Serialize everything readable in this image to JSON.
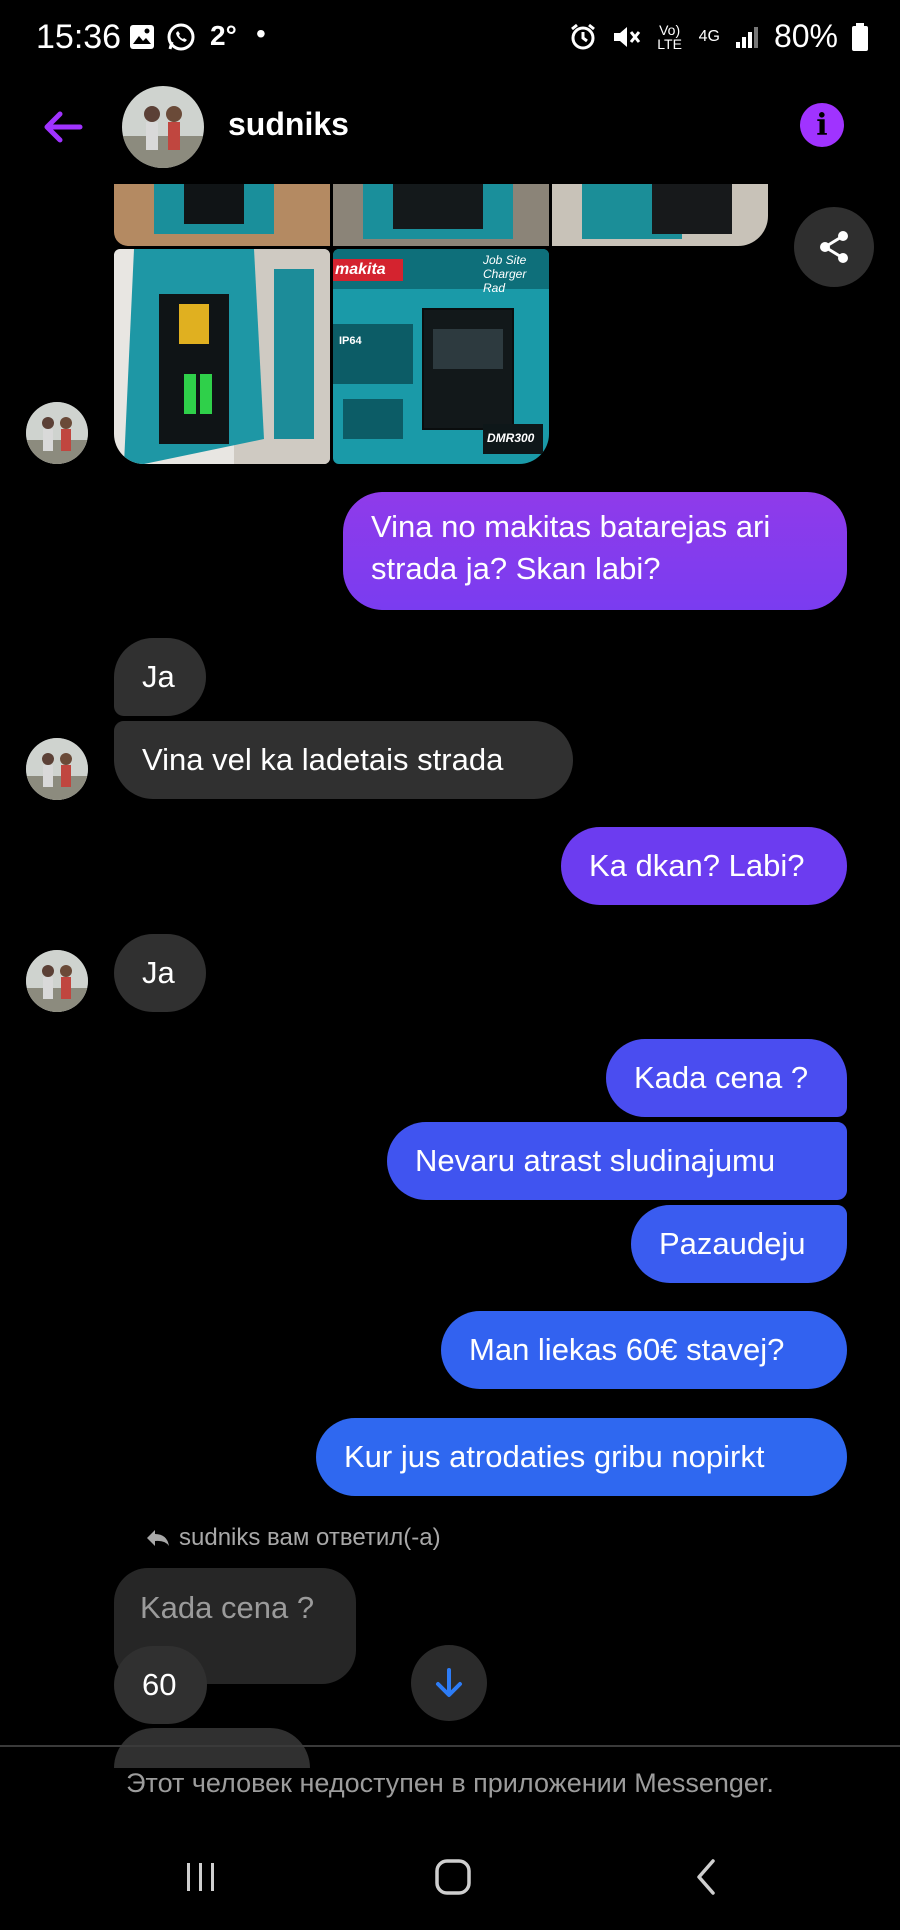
{
  "status_bar": {
    "time": "15:36",
    "temperature": "2°",
    "dot": "•",
    "network": "4G",
    "volte": "Vo) LTE",
    "battery": "80%"
  },
  "header": {
    "contact_name": "sudniks",
    "info_icon": "i"
  },
  "photos": {
    "box_brand": "makita",
    "box_title": "Job Site Charger Rad",
    "box_model": "DMR300",
    "box_rating": "IP64"
  },
  "messages": [
    {
      "from": "me",
      "text": "Vina no makitas batarejas ari strada ja? Skan labi?"
    },
    {
      "from": "them",
      "text": "Ja"
    },
    {
      "from": "them",
      "text": "Vina vel ka ladetais strada"
    },
    {
      "from": "me",
      "text": "Ka dkan? Labi?"
    },
    {
      "from": "them",
      "text": "Ja"
    },
    {
      "from": "me",
      "text": "Kada cena ?"
    },
    {
      "from": "me",
      "text": "Nevaru atrast sludinajumu"
    },
    {
      "from": "me",
      "text": "Pazaudeju"
    },
    {
      "from": "me",
      "text": "Man liekas 60€ stavej?"
    },
    {
      "from": "me",
      "text": "Kur jus atrodaties gribu nopirkt"
    }
  ],
  "reply": {
    "label": "sudniks вам ответил(-а)",
    "quoted_text": "Kada cena ?",
    "reply_text": "60"
  },
  "footer": {
    "unavailable_notice": "Этот человек недоступен в приложении Messenger."
  },
  "colors": {
    "accent": "#a033ff",
    "bubble_in": "#303030",
    "bubble_out_top": "#7a3cf0",
    "bubble_out_bottom": "#2f6bf0"
  }
}
